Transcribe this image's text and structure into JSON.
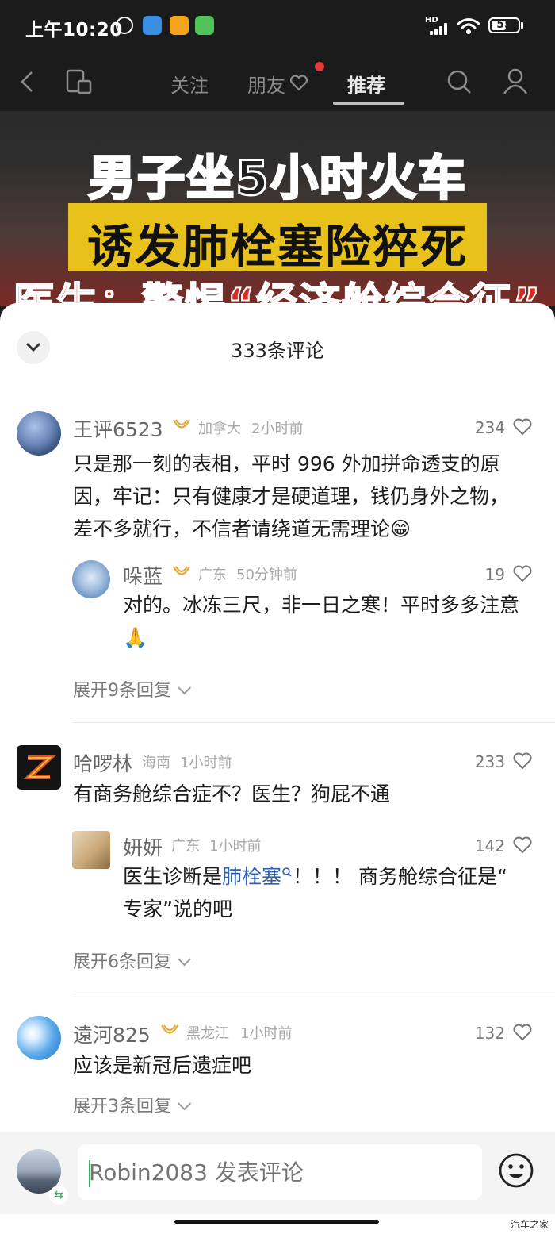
{
  "status_bar": {
    "time": "上午10:20",
    "network": "HD",
    "battery": "55"
  },
  "nav": {
    "tabs": {
      "follow": "关注",
      "friends": "朋友",
      "recommend": "推荐"
    }
  },
  "video": {
    "line1": "男子坐5小时火车",
    "line2": "诱发肺栓塞险猝死",
    "line3": "医生：警惕“经济舱综合征”"
  },
  "sheet": {
    "title": "333条评论"
  },
  "comments": [
    {
      "user": "王评6523",
      "location": "加拿大",
      "time": "2小时前",
      "likes": "234",
      "text_line1": "只是那一刻的表相，平时 996 外加拼命透支的原",
      "text_line2": "因，牢记：只有健康才是硬道理，钱仍身外之物，",
      "text_line3": "差不多就行，不信者请绕道无需理论😁",
      "reply": {
        "user": "哚蓝",
        "location": "广东",
        "time": "50分钟前",
        "likes": "19",
        "text_line1": "对的。冰冻三尺，非一日之寒！平时多多注意",
        "text_line2": "🙏"
      },
      "expand": "展开9条回复"
    },
    {
      "user": "哈啰林",
      "location": "海南",
      "time": "1小时前",
      "likes": "233",
      "text": "有商务舱综合症不？医生？狗屁不通",
      "reply": {
        "user": "妍妍",
        "location": "广东",
        "time": "1小时前",
        "likes": "142",
        "text_before": "医生诊断是",
        "text_link": "肺栓塞",
        "text_after": "！！！ 商务舱综合征是“",
        "text_line2": "专家”说的吧"
      },
      "expand": "展开6条回复"
    },
    {
      "user": "遠河825",
      "location": "黑龙江",
      "time": "1小时前",
      "likes": "132",
      "text": "应该是新冠后遗症吧",
      "expand": "展开3条回复"
    }
  ],
  "input": {
    "placeholder": "Robin2083 发表评论"
  },
  "watermark": "汽车之家",
  "colors": {
    "accent_green": "#2eb35a",
    "link_blue": "#2f5fb3",
    "vip_gold": "#e2a93b",
    "notify_red": "#e53a3a"
  }
}
